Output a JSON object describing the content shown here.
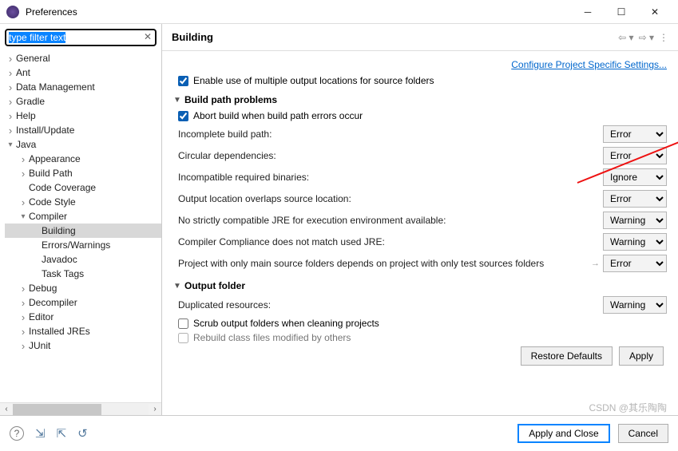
{
  "window": {
    "title": "Preferences"
  },
  "filter": {
    "placeholder": "type filter text"
  },
  "tree": [
    {
      "label": "General",
      "indent": 0,
      "arrow": "col"
    },
    {
      "label": "Ant",
      "indent": 0,
      "arrow": "col"
    },
    {
      "label": "Data Management",
      "indent": 0,
      "arrow": "col"
    },
    {
      "label": "Gradle",
      "indent": 0,
      "arrow": "col"
    },
    {
      "label": "Help",
      "indent": 0,
      "arrow": "col"
    },
    {
      "label": "Install/Update",
      "indent": 0,
      "arrow": "col"
    },
    {
      "label": "Java",
      "indent": 0,
      "arrow": "exp"
    },
    {
      "label": "Appearance",
      "indent": 1,
      "arrow": "col"
    },
    {
      "label": "Build Path",
      "indent": 1,
      "arrow": "col"
    },
    {
      "label": "Code Coverage",
      "indent": 1,
      "arrow": "none"
    },
    {
      "label": "Code Style",
      "indent": 1,
      "arrow": "col"
    },
    {
      "label": "Compiler",
      "indent": 1,
      "arrow": "exp"
    },
    {
      "label": "Building",
      "indent": 2,
      "arrow": "none",
      "selected": true
    },
    {
      "label": "Errors/Warnings",
      "indent": 2,
      "arrow": "none"
    },
    {
      "label": "Javadoc",
      "indent": 2,
      "arrow": "none"
    },
    {
      "label": "Task Tags",
      "indent": 2,
      "arrow": "none"
    },
    {
      "label": "Debug",
      "indent": 1,
      "arrow": "col"
    },
    {
      "label": "Decompiler",
      "indent": 1,
      "arrow": "col"
    },
    {
      "label": "Editor",
      "indent": 1,
      "arrow": "col"
    },
    {
      "label": "Installed JREs",
      "indent": 1,
      "arrow": "col"
    },
    {
      "label": "JUnit",
      "indent": 1,
      "arrow": "col"
    }
  ],
  "heading": "Building",
  "link": "Configure Project Specific Settings...",
  "enable_multi_output": {
    "checked": true,
    "label": "Enable use of multiple output locations for source folders"
  },
  "sections": {
    "build_path": {
      "title": "Build path problems",
      "abort": {
        "checked": true,
        "label": "Abort build when build path errors occur"
      },
      "rows": [
        {
          "label": "Incomplete build path:",
          "value": "Error"
        },
        {
          "label": "Circular dependencies:",
          "value": "Error"
        },
        {
          "label": "Incompatible required binaries:",
          "value": "Ignore"
        },
        {
          "label": "Output location overlaps source location:",
          "value": "Error"
        },
        {
          "label": "No strictly compatible JRE for execution environment available:",
          "value": "Warning"
        },
        {
          "label": "Compiler Compliance does not match used JRE:",
          "value": "Warning"
        },
        {
          "label": "Project with only main source folders depends on project with only test sources folders",
          "value": "Error",
          "goto": true
        }
      ]
    },
    "output": {
      "title": "Output folder",
      "rows": [
        {
          "label": "Duplicated resources:",
          "value": "Warning"
        }
      ],
      "scrub": {
        "checked": false,
        "label": "Scrub output folders when cleaning projects"
      },
      "rebuild": {
        "checked": false,
        "label": "Rebuild class files modified by others"
      }
    }
  },
  "select_options": [
    "Error",
    "Warning",
    "Ignore"
  ],
  "buttons": {
    "restore": "Restore Defaults",
    "apply": "Apply",
    "apply_close": "Apply and Close",
    "cancel": "Cancel"
  },
  "watermark": "CSDN @其乐陶陶"
}
